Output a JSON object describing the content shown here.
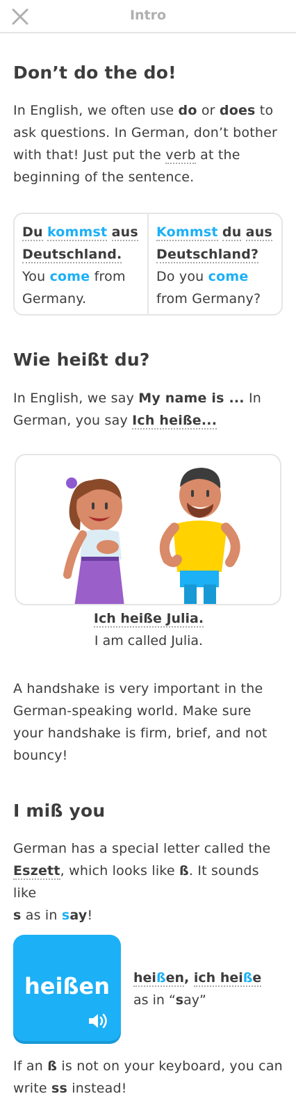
{
  "header": {
    "title": "Intro",
    "close_icon": "close-icon"
  },
  "s1": {
    "heading": "Don’t do the do!",
    "l1_a": "In English, we often use ",
    "l1_do": "do",
    "l1_or": " or ",
    "l1_does": "does",
    "l1_b": " to",
    "l2": "ask questions. In German, don’t bother",
    "l3_a": "with that! Just put the ",
    "l3_verb": "verb",
    "l3_b": " at the",
    "l4": "beginning of the sentence."
  },
  "table": {
    "left": {
      "du": "Du",
      "kommst": "kommst",
      "aus": "aus",
      "deutschland": "Deutschland.",
      "you": "You ",
      "come": "come",
      "from": " from",
      "germany": "Germany."
    },
    "right": {
      "kommst": "Kommst",
      "du": "du",
      "aus": "aus",
      "deutschland": "Deutschland?",
      "do_you": "Do you ",
      "come": "come",
      "from_germany": "from Germany?"
    }
  },
  "s2": {
    "heading": "Wie heißt du?",
    "l1_a": "In English, we say ",
    "l1_b": "My name is ...",
    "l1_c": " In",
    "l2_a": "German, you say  ",
    "l2_b": "Ich heiße..."
  },
  "caption": {
    "de": "Ich heiße Julia.",
    "en": "I am called Julia."
  },
  "s3": {
    "l1": "A handshake is very important in the",
    "l2": "German-speaking world. Make sure",
    "l3": "your handshake is firm, brief, and not",
    "l4": "bouncy!"
  },
  "s4": {
    "heading": "I miß you",
    "l1": "German has a special letter called the",
    "l2_a": "Eszett",
    "l2_b": ", which looks like ",
    "l2_c": "ß",
    "l2_d": ". It sounds like",
    "l3_a": "s",
    "l3_b": " as in ",
    "l3_c": "s",
    "l3_d": "ay",
    "l3_e": "!"
  },
  "card": {
    "word": "heißen",
    "speaker_icon": "speaker-icon"
  },
  "side": {
    "hei1": "hei",
    "ss1": "ß",
    "en1": "en",
    "comma": ", ",
    "ich": "ich",
    "hei2": "hei",
    "ss2": "ß",
    "e2": "e",
    "as_in": "as in “",
    "s": "s",
    "ay": "ay”"
  },
  "footer": {
    "l1_a": "If an ",
    "l1_b": "ß",
    "l1_c": " is not on your keyboard, you can",
    "l2_a": "write ",
    "l2_b": "ss",
    "l2_c": " instead!"
  },
  "colors": {
    "accent": "#1cb0f6",
    "text": "#3c3c3c",
    "border": "#e5e5e5",
    "muted": "#afafaf"
  }
}
